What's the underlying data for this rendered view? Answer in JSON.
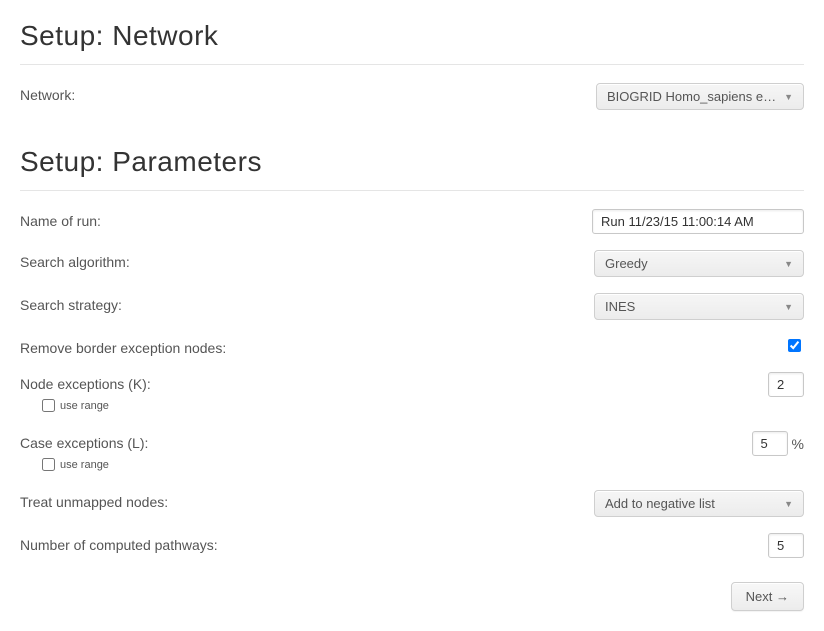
{
  "sections": {
    "network_title": "Setup: Network",
    "parameters_title": "Setup: Parameters"
  },
  "labels": {
    "network": "Network:",
    "name_of_run": "Name of run:",
    "search_algorithm": "Search algorithm:",
    "search_strategy": "Search strategy:",
    "remove_border": "Remove border exception nodes:",
    "node_exceptions": "Node exceptions (K):",
    "case_exceptions": "Case exceptions (L):",
    "use_range": "use range",
    "treat_unmapped": "Treat unmapped nodes:",
    "num_pathways": "Number of computed pathways:",
    "percent": "%"
  },
  "values": {
    "network_selected": "BIOGRID Homo_sapiens e…",
    "name_of_run": "Run 11/23/15 11:00:14 AM",
    "search_algorithm": "Greedy",
    "search_strategy": "INES",
    "remove_border": true,
    "node_exceptions_use_range": false,
    "node_exceptions": "2",
    "case_exceptions_use_range": false,
    "case_exceptions": "5",
    "treat_unmapped": "Add to negative list",
    "num_pathways": "5"
  },
  "buttons": {
    "next": "Next →"
  }
}
